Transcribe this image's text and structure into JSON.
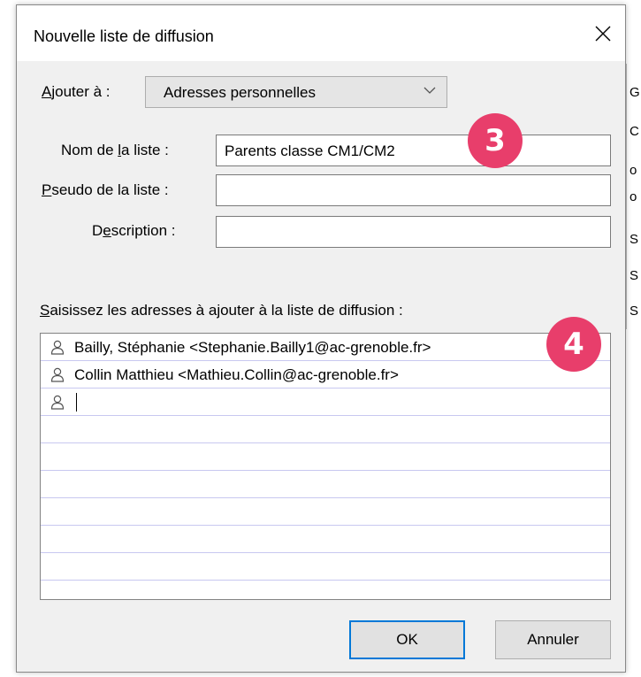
{
  "background_fragments": [
    "G",
    "C",
    "o",
    "o",
    "S",
    "S",
    "S"
  ],
  "dialog": {
    "title": "Nouvelle liste de diffusion",
    "add_to": {
      "label_pre": "",
      "label_ul": "A",
      "label_post": "jouter à :",
      "value": "Adresses personnelles"
    },
    "list_name": {
      "label_pre": "Nom de ",
      "label_ul": "l",
      "label_post": "a liste :",
      "value": "Parents classe CM1/CM2"
    },
    "nickname": {
      "label_pre": "",
      "label_ul": "P",
      "label_post": "seudo de la liste :",
      "value": ""
    },
    "description": {
      "label_pre": "D",
      "label_ul": "e",
      "label_post": "scription :",
      "value": ""
    },
    "addresses_label": {
      "label_pre": "",
      "label_ul": "S",
      "label_post": "aisissez les adresses à ajouter à la liste de diffusion :"
    },
    "addresses": [
      "Bailly, Stéphanie <Stephanie.Bailly1@ac-grenoble.fr>",
      "Collin Matthieu <Mathieu.Collin@ac-grenoble.fr>",
      ""
    ],
    "ok_label": "OK",
    "cancel_label": "Annuler"
  },
  "badges": [
    "3",
    "4"
  ],
  "colors": {
    "badge": "#e83e6b",
    "focus": "#0078d7",
    "row_line": "#c8c8f0"
  },
  "icons": {
    "close": "close-icon",
    "combo_arrow": "chevron-down-icon",
    "contact": "person-icon"
  }
}
